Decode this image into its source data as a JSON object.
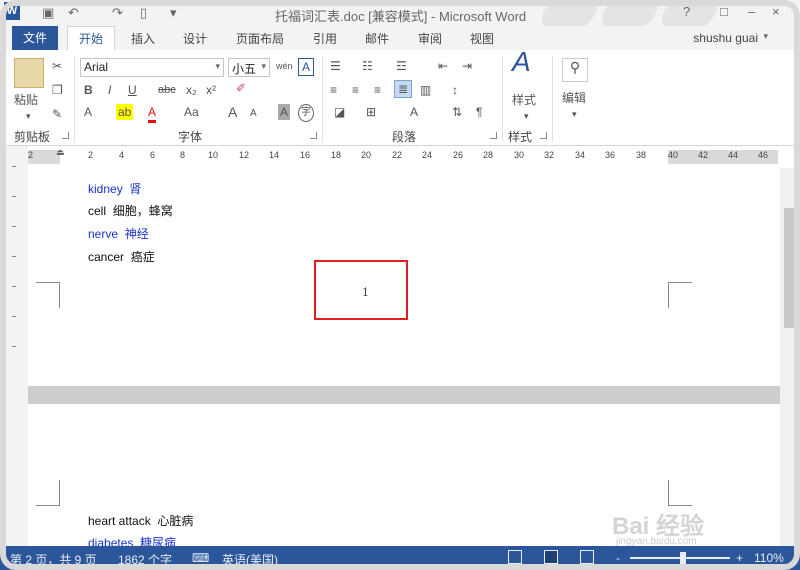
{
  "titlebar": {
    "title": "托福词汇表.doc [兼容模式] - Microsoft Word",
    "app_icon": "W",
    "min": "?",
    "restore": "□",
    "close": "×"
  },
  "tabs": {
    "file": "文件",
    "home": "开始",
    "insert": "插入",
    "design": "设计",
    "layout": "页面布局",
    "references": "引用",
    "mailings": "邮件",
    "review": "审阅",
    "view": "视图",
    "user": "shushu guai"
  },
  "ribbon": {
    "clipboard": {
      "paste": "粘贴",
      "label": "剪贴板"
    },
    "font": {
      "name": "Arial",
      "size": "小五",
      "wen": "wén",
      "label": "字体",
      "bold": "B",
      "italic": "I",
      "underline": "U",
      "strike": "abc",
      "sub": "x₂",
      "sup": "x²",
      "grow": "A",
      "shrink": "A",
      "case": "Aa",
      "clear": "A",
      "char_border": "A",
      "enclose": "字",
      "phonetic_box": "A"
    },
    "paragraph": {
      "label": "段落"
    },
    "styles": {
      "label": "样式",
      "btn": "样式"
    },
    "editing": {
      "btn": "编辑"
    }
  },
  "ruler": {
    "ticks": [
      "2",
      "2",
      "4",
      "6",
      "8",
      "10",
      "12",
      "14",
      "16",
      "18",
      "20",
      "22",
      "24",
      "26",
      "28",
      "30",
      "32",
      "34",
      "36",
      "38",
      "40",
      "42",
      "44",
      "46"
    ]
  },
  "document": {
    "page1_lines": [
      {
        "en": "kidney",
        "zh": "肾",
        "color": "#1a33c8"
      },
      {
        "en": "cell",
        "zh": "细胞，蜂窝",
        "color": "#111111"
      },
      {
        "en": "nerve",
        "zh": "神经",
        "color": "#1a33c8"
      },
      {
        "en": "cancer",
        "zh": "癌症",
        "color": "#111111"
      }
    ],
    "page_number": "1",
    "page2_lines": [
      {
        "en": "heart attack",
        "zh": "心脏病",
        "color": "#111111"
      },
      {
        "en": "diabetes",
        "zh": "糖尿病",
        "color": "#1a33c8"
      }
    ]
  },
  "status": {
    "page": "第 2 页，共 9 页",
    "words": "1862 个字",
    "lang": "英语(美国)",
    "zoom": "110%",
    "zoom_minus": "-",
    "zoom_plus": "+"
  },
  "watermark": {
    "main": "Bai 经验",
    "sub": "jingyan.baidu.com"
  },
  "colors": {
    "accent": "#2b579a",
    "highlight": "#e11d1d",
    "blue_text": "#1a33c8"
  }
}
